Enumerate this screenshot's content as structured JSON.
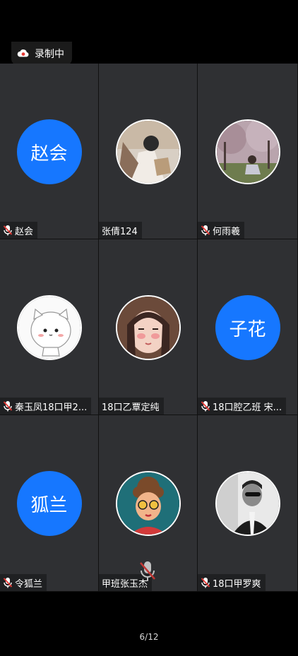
{
  "recording": {
    "label": "录制中",
    "icon": "cloud-record-icon"
  },
  "participants": [
    {
      "name": "赵会",
      "avatar_text": "赵会",
      "mic": "muted"
    },
    {
      "name": "张倩124",
      "avatar": "photo",
      "mic": "none"
    },
    {
      "name": "何雨羲",
      "avatar": "photo",
      "mic": "muted"
    },
    {
      "name": "秦玉凤18口甲2...",
      "avatar": "cartoon-cat",
      "mic": "muted"
    },
    {
      "name": "18口乙覃定纯",
      "avatar": "photo",
      "mic": "none"
    },
    {
      "name": "18口腔乙班 宋...",
      "avatar_text": "子花",
      "mic": "muted"
    },
    {
      "name": "令狐兰",
      "avatar_text": "狐兰",
      "mic": "muted"
    },
    {
      "name": "甲班张玉杰",
      "avatar": "cartoon-girl",
      "mic": "none"
    },
    {
      "name": "18口甲罗爽",
      "avatar": "photo",
      "mic": "muted"
    }
  ],
  "pagination": {
    "text": "6/12"
  },
  "colors": {
    "accent": "#1677ff",
    "mic_muted": "#e53935",
    "tile_bg": "#2f3033"
  }
}
